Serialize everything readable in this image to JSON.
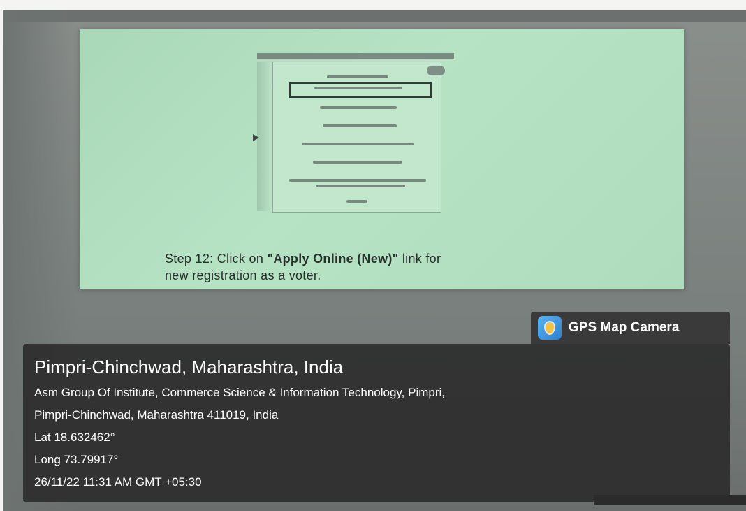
{
  "slide": {
    "caption_prefix": "Step 12: Click on ",
    "caption_link": "\"Apply Online (New)\"",
    "caption_suffix": " link for",
    "caption_line2": "new registration as a voter."
  },
  "badge": {
    "icon": "gps-map-camera-icon",
    "label": "GPS Map Camera"
  },
  "location": {
    "title": "Pimpri-Chinchwad, Maharashtra, India",
    "address_line1": "Asm Group Of Institute, Commerce Science & Information Technology, Pimpri,",
    "address_line2": "Pimpri-Chinchwad, Maharashtra 411019, India",
    "lat": "Lat 18.632462°",
    "long": "Long 73.79917°",
    "datetime": "26/11/22 11:31 AM GMT +05:30"
  }
}
